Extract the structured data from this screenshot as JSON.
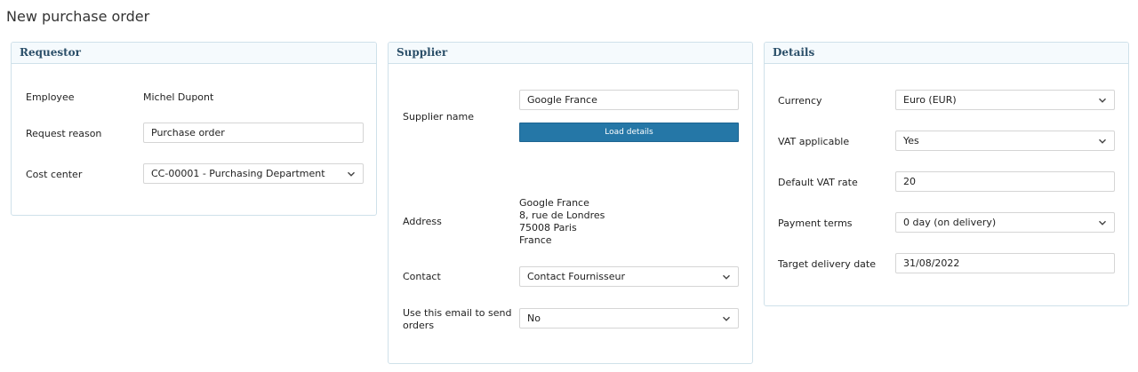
{
  "page_title": "New purchase order",
  "requestor": {
    "title": "Requestor",
    "employee_label": "Employee",
    "employee_value": "Michel Dupont",
    "reason_label": "Request reason",
    "reason_value": "Purchase order",
    "cost_center_label": "Cost center",
    "cost_center_value": "CC-00001 - Purchasing Department"
  },
  "supplier": {
    "title": "Supplier",
    "name_label": "Supplier name",
    "name_value": "Google France",
    "load_details_label": "Load details",
    "address_label": "Address",
    "address_lines": [
      "Google France",
      "8, rue de Londres",
      "75008 Paris",
      "France"
    ],
    "contact_label": "Contact",
    "contact_value": "Contact Fournisseur",
    "email_label_line1": "Use this email to send",
    "email_label_line2": "orders",
    "email_value": "No"
  },
  "details": {
    "title": "Details",
    "currency_label": "Currency",
    "currency_value": "Euro (EUR)",
    "vat_label": "VAT applicable",
    "vat_value": "Yes",
    "vat_rate_label": "Default VAT rate",
    "vat_rate_value": "20",
    "payment_label": "Payment terms",
    "payment_value": "0 day (on delivery)",
    "delivery_label": "Target delivery date",
    "delivery_value": "31/08/2022"
  },
  "icons": {
    "select_arrow": "chevron-down-icon"
  }
}
